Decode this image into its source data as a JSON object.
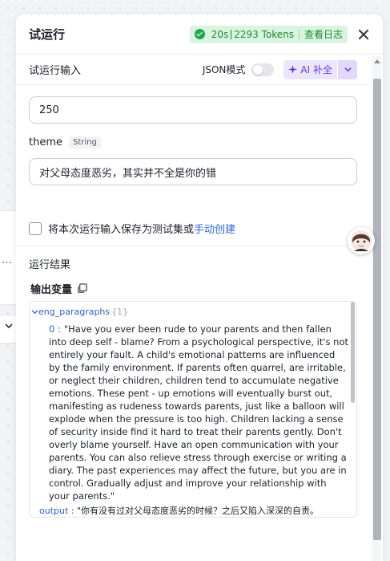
{
  "header": {
    "title": "试运行",
    "status_time": "20s",
    "status_tokens": "2293 Tokens",
    "view_log": "查看日志"
  },
  "input_section": {
    "title": "试运行输入",
    "json_mode": "JSON模式",
    "ai_button": "AI 补全"
  },
  "fields": {
    "first_value": "250",
    "theme_label": "theme",
    "theme_type": "String",
    "theme_value": "对父母态度恶劣，其实并不全是你的错"
  },
  "save_option": {
    "text": "将本次运行输入保存为测试集或",
    "link": "手动创建"
  },
  "result": {
    "title": "运行结果",
    "output_var": "输出变量",
    "root_key": "eng_paragraphs",
    "root_count": "{1}",
    "item_key": "0 :",
    "item_value": "\"Have you ever been rude to your parents and then fallen into deep self - blame? From a psychological perspective, it's not entirely your fault. A child's emotional patterns are influenced by the family environment. If parents often quarrel, are irritable, or neglect their children, children tend to accumulate negative emotions. These pent - up emotions will eventually burst out, manifesting as rudeness towards parents, just like a balloon will explode when the pressure is too high. Children lacking a sense of security inside find it hard to treat their parents gently. Don't overly blame yourself. Have an open communication with your parents. You can also relieve stress through exercise or writing a diary. The past experiences may affect the future, but you are in control. Gradually adjust and improve your relationship with your parents.\"",
    "output_key": "output :",
    "output_value": "\"你有没有过对父母态度恶劣的时候？之后又陷入深深的自责。"
  },
  "colors": {
    "accent_purple": "#6a3be4",
    "success_green": "#21a84a",
    "link_blue": "#2c6be3"
  }
}
